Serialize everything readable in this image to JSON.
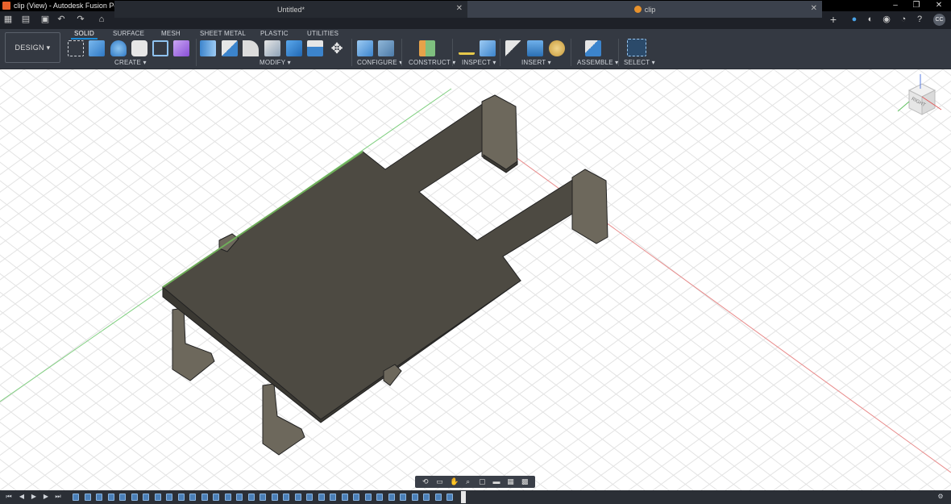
{
  "window": {
    "title": "clip (View) - Autodesk Fusion Personal (Not for Commercial Use)",
    "controls": [
      "–",
      "❐",
      "✕"
    ]
  },
  "tabs": [
    {
      "label": "Untitled*",
      "close": "✕"
    },
    {
      "label": "clip",
      "close": "✕"
    }
  ],
  "user": {
    "initials": "CC"
  },
  "toolbar": {
    "workspace": "DESIGN ▾",
    "workspace_tabs": [
      "SOLID",
      "SURFACE",
      "MESH",
      "SHEET METAL",
      "PLASTIC",
      "UTILITIES"
    ],
    "groups": [
      "CREATE ▾",
      "MODIFY ▾",
      "CONFIGURE ▾",
      "CONSTRUCT ▾",
      "INSPECT ▾",
      "INSERT ▾",
      "ASSEMBLE ▾",
      "SELECT ▾"
    ]
  },
  "viewcube": {
    "face_label": "RIGHT"
  },
  "colors": {
    "title_bar": "#000000",
    "tab_bar": "#1e2128",
    "toolbar": "#343942",
    "accent": "#1b8ad6",
    "model_top": "#4d4a42",
    "model_side": "#6d685c",
    "model_dark": "#3a3832",
    "axis_x": "#e06060",
    "axis_y": "#60c060"
  },
  "icons": {
    "tabbar": [
      "apps-grid-icon",
      "file-menu-icon",
      "save-icon",
      "undo-icon",
      "redo-icon",
      "home-icon",
      "new-tab-icon",
      "extensions-icon",
      "job-status-icon",
      "online-icon",
      "notifications-icon",
      "help-icon"
    ],
    "navbar": [
      "orbit-icon",
      "look-at-icon",
      "pan-icon",
      "zoom-icon",
      "fit-icon",
      "display-settings-icon",
      "grid-settings-icon",
      "viewports-icon"
    ],
    "timeline": [
      "go-start-icon",
      "step-back-icon",
      "play-icon",
      "step-forward-icon",
      "go-end-icon",
      "timeline-settings-icon"
    ]
  }
}
